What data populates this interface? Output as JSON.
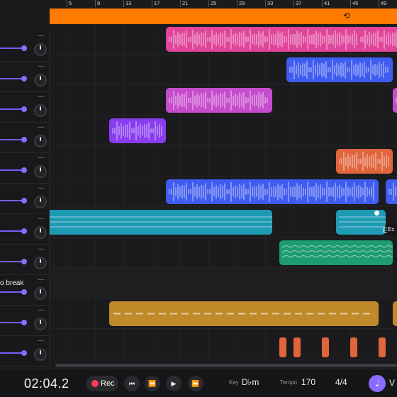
{
  "ruler": {
    "bars": [
      "5",
      "9",
      "13",
      "17",
      "21",
      "25",
      "29",
      "33",
      "37",
      "41",
      "45",
      "49"
    ]
  },
  "loop": {
    "icon": "loop-icon"
  },
  "tracks": [
    {
      "id": "t1",
      "label": "",
      "color": "#e0459b"
    },
    {
      "id": "t2",
      "label": "",
      "color": "#3f5cf0"
    },
    {
      "id": "t3",
      "label": "",
      "color": "#c64ccc"
    },
    {
      "id": "t4",
      "label": "",
      "color": "#8a3cf0"
    },
    {
      "id": "t5",
      "label": "",
      "color": "#e0643c"
    },
    {
      "id": "t6",
      "label": "",
      "color": "#3f5cf0"
    },
    {
      "id": "t7",
      "label": "",
      "color": "#1f9ab3"
    },
    {
      "id": "t8",
      "label": "",
      "color": "#1f9b70"
    },
    {
      "id": "t9",
      "label": "o break",
      "color": "#2f9b46"
    },
    {
      "id": "t10",
      "label": "",
      "color": "#c08a2a"
    },
    {
      "id": "t11",
      "label": "",
      "color": "#e0643c"
    }
  ],
  "clip_tooltip": "Ec",
  "clip_letter": "E",
  "transport": {
    "time": "02:04.2",
    "rec_label": "Rec",
    "key_label": "Key",
    "key_value": "D♭m",
    "tempo_label": "Tempo",
    "tempo_value": "170",
    "signature": "4/4",
    "more_label": "V"
  },
  "colors": {
    "accent": "#8a6cff",
    "loop": "#ff7a00",
    "record": "#ff3b5c"
  }
}
